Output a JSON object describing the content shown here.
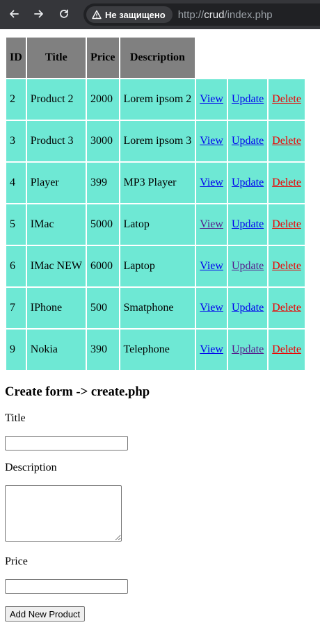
{
  "browser": {
    "security_chip": "Не защищено",
    "url_scheme": "http://",
    "url_host": "crud",
    "url_path": "/index.php"
  },
  "table": {
    "headers": [
      "ID",
      "Title",
      "Price",
      "Description"
    ],
    "rows": [
      {
        "id": "2",
        "title": "Product 2",
        "price": "2000",
        "description": "Lorem ipsom 2",
        "view": "View",
        "update": "Update",
        "delete": "Delete"
      },
      {
        "id": "3",
        "title": "Product 3",
        "price": "3000",
        "description": "Lorem ipsom 3",
        "view": "View",
        "update": "Update",
        "delete": "Delete"
      },
      {
        "id": "4",
        "title": "Player",
        "price": "399",
        "description": "MP3 Player",
        "view": "View",
        "update": "Update",
        "delete": "Delete"
      },
      {
        "id": "5",
        "title": "IMac",
        "price": "5000",
        "description": "Latop",
        "view": "View",
        "update": "Update",
        "delete": "Delete"
      },
      {
        "id": "6",
        "title": "IMac NEW",
        "price": "6000",
        "description": "Laptop",
        "view": "View",
        "update": "Update",
        "delete": "Delete"
      },
      {
        "id": "7",
        "title": "IPhone",
        "price": "500",
        "description": "Smatphone",
        "view": "View",
        "update": "Update",
        "delete": "Delete"
      },
      {
        "id": "9",
        "title": "Nokia",
        "price": "390",
        "description": "Telephone",
        "view": "View",
        "update": "Update",
        "delete": "Delete"
      }
    ]
  },
  "form": {
    "heading": "Create form -> create.php",
    "title_label": "Title",
    "title_value": "",
    "description_label": "Description",
    "description_value": "",
    "price_label": "Price",
    "price_value": "",
    "submit_label": "Add New Product"
  },
  "colors": {
    "header_bg": "#808080",
    "cell_bg": "#6ee8d4",
    "link": "#0000ee",
    "delete_link": "#ee0000",
    "visited_link": "#551a8b"
  }
}
